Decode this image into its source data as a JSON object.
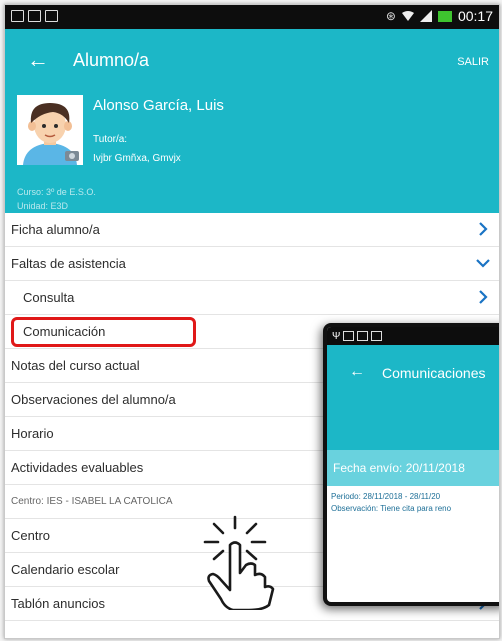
{
  "status_bar": {
    "time": "00:17",
    "icons": [
      "image-icon",
      "cast-icon",
      "document-icon",
      "vibrate-icon",
      "wifi-icon",
      "signal-icon",
      "battery-icon"
    ]
  },
  "app_bar": {
    "title": "Alumno/a",
    "salir": "SALIR",
    "back_icon": "arrow-left-icon"
  },
  "profile": {
    "name": "Alonso García, Luis",
    "tutor_label": "Tutor/a:",
    "tutor_name": "Ivjbr Gmñxa, Gmvjx",
    "curso": "Curso:  3º de E.S.O.",
    "unidad": "Unidad: E3D"
  },
  "menu": {
    "ficha": "Ficha alumno/a",
    "faltas": "Faltas de asistencia",
    "consulta": "Consulta",
    "comunicacion": "Comunicación",
    "notas": "Notas del curso actual",
    "observaciones": "Observaciones del alumno/a",
    "horario": "Horario",
    "actividades": "Actividades evaluables",
    "centro_info": "Centro: IES - ISABEL LA CATOLICA",
    "centro": "Centro",
    "calendario": "Calendario escolar",
    "tablon": "Tablón anuncios"
  },
  "inset": {
    "title": "Comunicaciones",
    "fecha": "Fecha envío: 20/11/2018",
    "periodo": "Periodo: 28/11/2018 - 28/11/20",
    "observacion": "Observación: Tiene cita para reno"
  },
  "colors": {
    "teal": "#1cb7c7",
    "light_teal": "#69d2de",
    "chevron_blue": "#1a73c4",
    "highlight_red": "#e01818",
    "highlight_bg": "#fffbe0"
  }
}
